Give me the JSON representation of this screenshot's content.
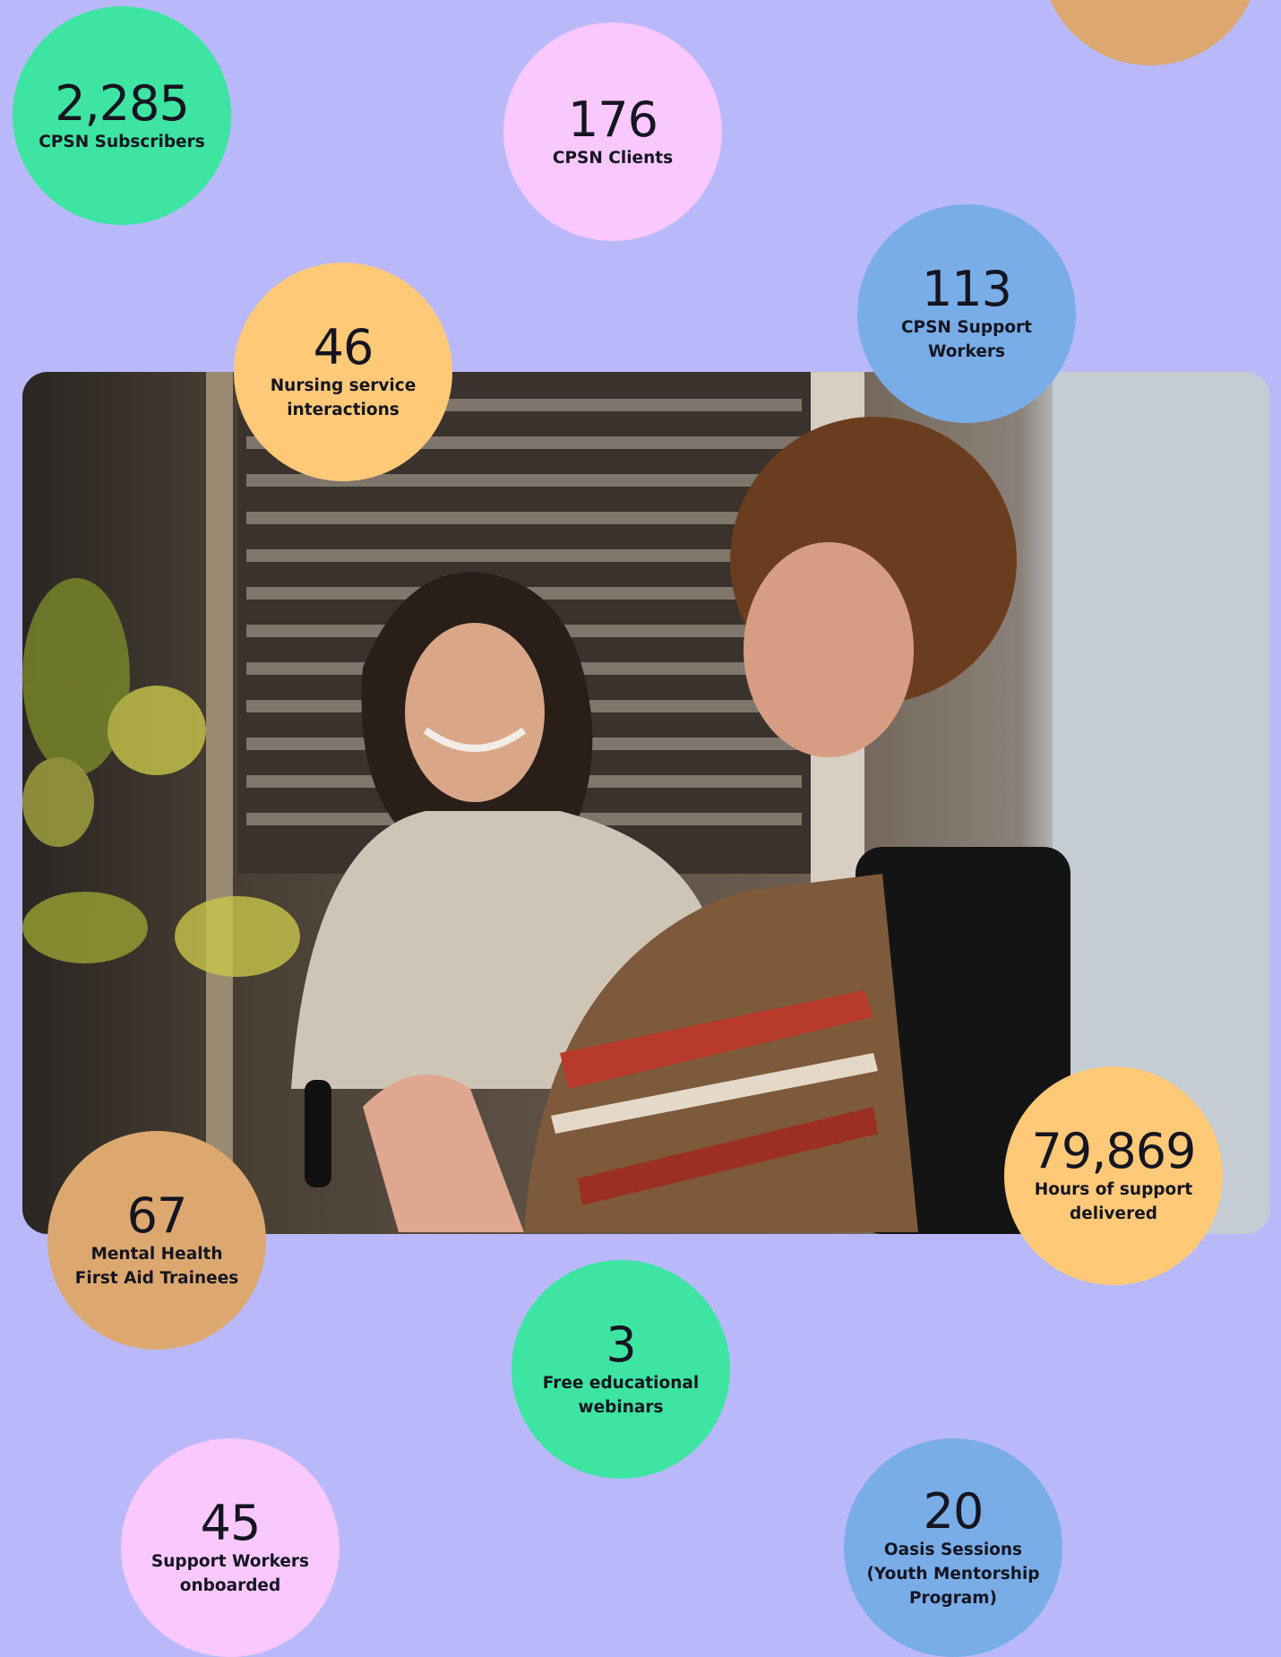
{
  "colors": {
    "background": "#b9b9fa",
    "green": "#3ee4a2",
    "pink": "#f8c8ff",
    "blue": "#79ade8",
    "yellow": "#ffc978",
    "tan": "#dca870"
  },
  "photo": {
    "subject": "support-worker-with-client-photo"
  },
  "stats": {
    "subscribers": {
      "value": "2,285",
      "label": "CPSN Subscribers"
    },
    "clients": {
      "value": "176",
      "label": "CPSN Clients"
    },
    "support_workers": {
      "value": "113",
      "label": "CPSN Support Workers"
    },
    "nursing": {
      "value": "46",
      "label": "Nursing service interactions"
    },
    "hours": {
      "value": "79,869",
      "label": "Hours of support delivered"
    },
    "mental_health": {
      "value": "67",
      "label": "Mental Health First Aid Trainees"
    },
    "webinars": {
      "value": "3",
      "label": "Free educational webinars"
    },
    "onboarded": {
      "value": "45",
      "label": "Support Workers onboarded"
    },
    "oasis": {
      "value": "20",
      "label": "Oasis Sessions (Youth Mentorship Program)"
    }
  }
}
